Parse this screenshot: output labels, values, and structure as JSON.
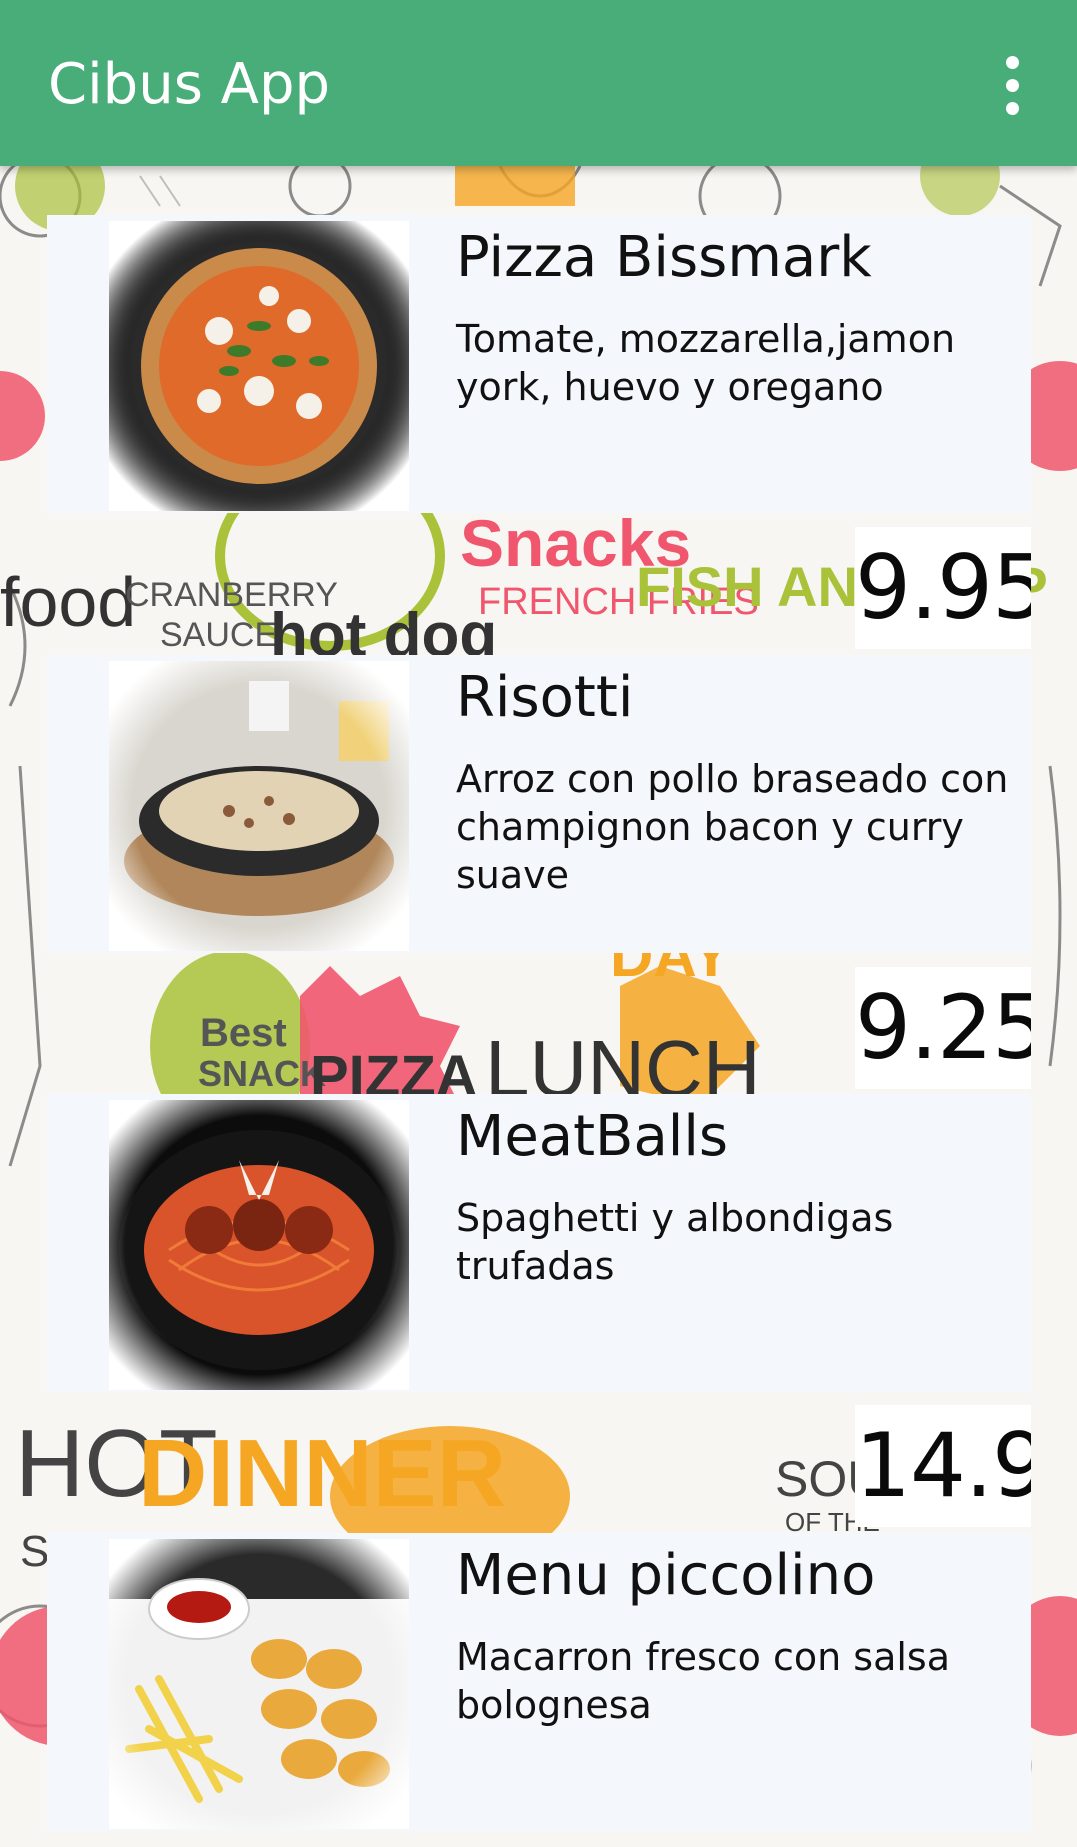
{
  "app": {
    "title": "Cibus App",
    "accent_color": "#48ad78",
    "menu_icon": "more-vert-icon"
  },
  "items": [
    {
      "name": "Pizza Bissmark",
      "description": "Tomate, mozzarella,jamon york, huevo y oregano",
      "price": "9.95",
      "image_icon": "pizza-image"
    },
    {
      "name": "Risotti",
      "description": "Arroz con pollo braseado con champignon bacon y curry suave",
      "price": "9.25",
      "image_icon": "risotto-image"
    },
    {
      "name": "MeatBalls",
      "description": "Spaghetti y albondigas trufadas",
      "price": "14.9",
      "image_icon": "spaghetti-meatballs-image"
    },
    {
      "name": "Menu piccolino",
      "description": "Macarron fresco con salsa bolognesa",
      "price": "",
      "image_icon": "nuggets-fries-image"
    }
  ],
  "background": {
    "style": "food doodle pattern",
    "words": [
      "food",
      "CRANBERRY SAUCE",
      "hot dog",
      "Snacks",
      "FRENCH FRIES",
      "FISH AND CHIP",
      "Best SNACK",
      "PIZZA",
      "LUNCH",
      "DAY",
      "HOT",
      "SNACKS",
      "DINNER",
      "SOUP",
      "OF THE"
    ]
  }
}
